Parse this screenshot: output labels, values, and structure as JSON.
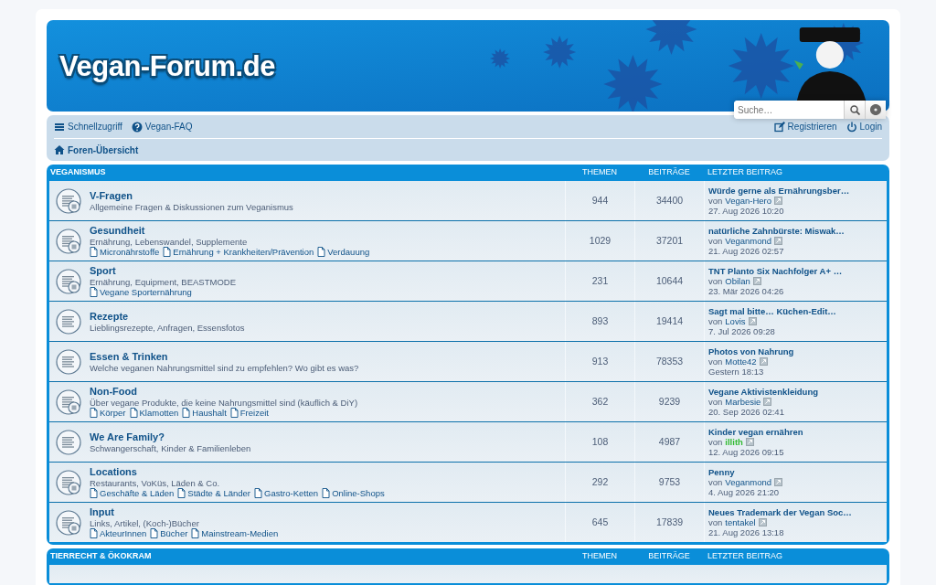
{
  "header": {
    "logo": "Vegan-Forum.de",
    "search": {
      "placeholder": "Suche…"
    }
  },
  "navbar": {
    "links_left": [
      {
        "label": "Schnellzugriff"
      },
      {
        "label": "Vegan-FAQ"
      }
    ],
    "links_right": [
      {
        "label": "Registrieren"
      },
      {
        "label": "Login"
      }
    ],
    "breadcrumb": {
      "label": "Foren-Übersicht"
    }
  },
  "sections": [
    {
      "title": "VEGANISMUS",
      "columns": [
        "THEMEN",
        "BEITRÄGE",
        "LETZTER BEITRAG"
      ],
      "forums": [
        {
          "title": "V-Fragen",
          "description": "Allgemeine Fragen & Diskussionen zum Veganismus",
          "icon_badge": true,
          "topics": "944",
          "posts": "34400",
          "last_post": {
            "title": "Würde gerne als Ernährungsber…",
            "by_label": "von",
            "author": "Vegan-Hero",
            "author_highlighted": false,
            "time": "27. Aug 2026 10:20"
          }
        },
        {
          "title": "Gesundheit",
          "description": "Ernährung, Lebenswandel, Supplemente",
          "icon_badge": true,
          "subforums": [
            "Micronährstoffe",
            "Ernährung + Krankheiten/Prävention",
            "Verdauung"
          ],
          "topics": "1029",
          "posts": "37201",
          "last_post": {
            "title": "natürliche Zahnbürste: Miswak…",
            "by_label": "von",
            "author": "Veganmond",
            "author_highlighted": false,
            "time": "21. Aug 2026 02:57"
          }
        },
        {
          "title": "Sport",
          "description": "Ernährung, Equipment, BEASTMODE",
          "icon_badge": true,
          "subforums": [
            "Vegane Sporternährung"
          ],
          "topics": "231",
          "posts": "10644",
          "last_post": {
            "title": "TNT Planto Six Nachfolger A+ …",
            "by_label": "von",
            "author": "Obilan",
            "author_highlighted": false,
            "time": "23. Mär 2026 04:26"
          }
        },
        {
          "title": "Rezepte",
          "description": "Lieblingsrezepte, Anfragen, Essensfotos",
          "icon_badge": false,
          "topics": "893",
          "posts": "19414",
          "last_post": {
            "title": "Sagt mal bitte… Küchen-Edit…",
            "by_label": "von",
            "author": "Lovis",
            "author_highlighted": false,
            "time": "7. Jul 2026 09:28"
          }
        },
        {
          "title": "Essen & Trinken",
          "description": "Welche veganen Nahrungsmittel sind zu empfehlen? Wo gibt es was?",
          "icon_badge": false,
          "topics": "913",
          "posts": "78353",
          "last_post": {
            "title": "Photos von Nahrung",
            "by_label": "von",
            "author": "Motte42",
            "author_highlighted": false,
            "time": "Gestern 18:13"
          }
        },
        {
          "title": "Non-Food",
          "description": "Über vegane Produkte, die keine Nahrungsmittel sind (käuflich & DiY)",
          "icon_badge": true,
          "subforums": [
            "Körper",
            "Klamotten",
            "Haushalt",
            "Freizeit"
          ],
          "topics": "362",
          "posts": "9239",
          "last_post": {
            "title": "Vegane Aktivistenkleidung",
            "by_label": "von",
            "author": "Marbesie",
            "author_highlighted": false,
            "time": "20. Sep 2026 02:41"
          }
        },
        {
          "title": "We Are Family?",
          "description": "Schwangerschaft, Kinder & Familienleben",
          "icon_badge": false,
          "topics": "108",
          "posts": "4987",
          "last_post": {
            "title": "Kinder vegan ernähren",
            "by_label": "von",
            "author": "illith",
            "author_highlighted": true,
            "time": "12. Aug 2026 09:15"
          }
        },
        {
          "title": "Locations",
          "description": "Restaurants, VoKüs, Läden & Co.",
          "icon_badge": true,
          "subforums": [
            "Geschäfte & Läden",
            "Städte & Länder",
            "Gastro-Ketten",
            "Online-Shops"
          ],
          "topics": "292",
          "posts": "9753",
          "last_post": {
            "title": "Penny",
            "by_label": "von",
            "author": "Veganmond",
            "author_highlighted": false,
            "time": "4. Aug 2026 21:20"
          }
        },
        {
          "title": "Input",
          "description": "Links, Artikel, (Koch-)Bücher",
          "icon_badge": true,
          "subforums": [
            "AkteurInnen",
            "Bücher",
            "Mainstream-Medien"
          ],
          "topics": "645",
          "posts": "17839",
          "last_post": {
            "title": "Neues Trademark der Vegan Soc…",
            "by_label": "von",
            "author": "tentakel",
            "author_highlighted": false,
            "time": "21. Aug 2026 13:18"
          }
        }
      ]
    },
    {
      "title": "TIERRECHT & ÖKOKRAM",
      "columns": [
        "THEMEN",
        "BEITRÄGE",
        "LETZTER BEITRAG"
      ]
    }
  ]
}
